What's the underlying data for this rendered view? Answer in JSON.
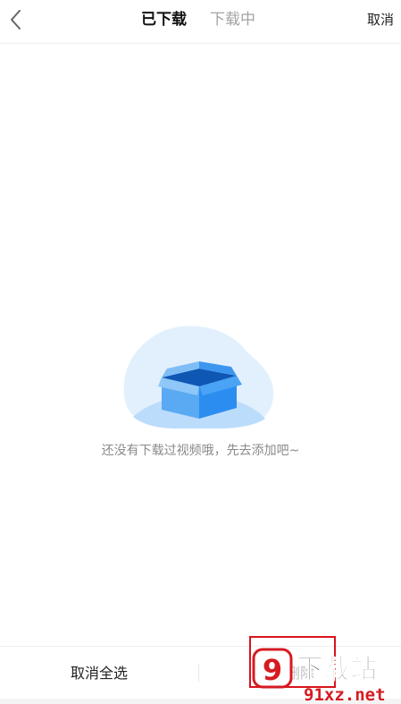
{
  "header": {
    "tab_downloaded": "已下载",
    "tab_downloading": "下载中",
    "cancel_label": "取消",
    "back_icon": "chevron-left-icon"
  },
  "empty_state": {
    "illustration": "empty-box-icon",
    "message": "还没有下载过视频哦，先去添加吧~"
  },
  "bottom_bar": {
    "select_all_label": "取消全选",
    "delete_label": "删除"
  },
  "watermark": {
    "logo_mark": "9",
    "brand_name": "下载站",
    "site_url": "91xz.net"
  },
  "colors": {
    "accent_blue": "#1a8cf0",
    "highlight_red": "#d9141b",
    "watermark_red": "#d51b21",
    "muted_text": "#8a8a8a",
    "disabled_text": "#bfbfbf"
  }
}
